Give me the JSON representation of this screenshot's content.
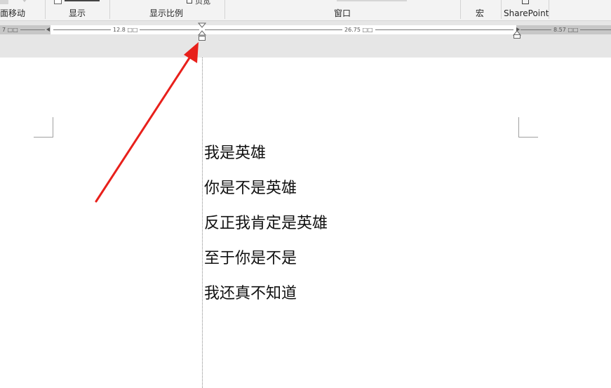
{
  "ribbon": {
    "groups": [
      {
        "label": "面移动"
      },
      {
        "label": "显示"
      },
      {
        "label": "显示比例"
      },
      {
        "label": "窗口"
      },
      {
        "label": "宏"
      },
      {
        "label": "SharePoint"
      }
    ],
    "partial_top_text": "页宽"
  },
  "ruler": {
    "left_margin_label": "7 □□",
    "column1_width_label": "12.8 □□",
    "column2_width_label": "26.75 □□",
    "right_margin_label": "8.57 □□"
  },
  "document": {
    "lines": [
      "我是英雄",
      "你是不是英雄",
      "反正我肯定是英雄",
      "至于你是不是",
      "我还真不知道"
    ]
  },
  "annotation": {
    "arrow_color": "#e8201b"
  }
}
